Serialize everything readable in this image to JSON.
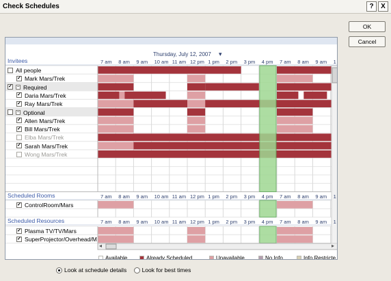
{
  "window": {
    "title": "Check Schedules",
    "help_label": "?",
    "close_label": "X"
  },
  "buttons": {
    "ok": "OK",
    "cancel": "Cancel"
  },
  "date_header": "Thursday, July 12, 2007",
  "sections": {
    "invitees": "Invitees",
    "rooms": "Scheduled Rooms",
    "resources": "Scheduled Resources"
  },
  "time_labels": [
    "7 am",
    "8 am",
    "9 am",
    "10 am",
    "11 am",
    "12 pm",
    "1 pm",
    "2 pm",
    "3 pm",
    "4 pm",
    "7 am",
    "8 am",
    "9 am",
    "1"
  ],
  "invitees": [
    {
      "label": "All people",
      "checkbox": "empty",
      "indent": 0,
      "dim": false
    },
    {
      "label": "Mark Mars/Trek",
      "checkbox": "checked",
      "indent": 1,
      "dim": false
    },
    {
      "label": "Required",
      "checkbox": "checked",
      "expander": "−",
      "indent": 0,
      "dim": false
    },
    {
      "label": "Daria Mars/Trek",
      "checkbox": "checked",
      "indent": 1,
      "dim": false
    },
    {
      "label": "Ray Mars/Trek",
      "checkbox": "checked",
      "indent": 1,
      "dim": false
    },
    {
      "label": "Optional",
      "checkbox": "empty",
      "expander": "−",
      "indent": 0,
      "dim": false
    },
    {
      "label": "Allen Mars/Trek",
      "checkbox": "checked",
      "indent": 1,
      "dim": false
    },
    {
      "label": "Bill Mars/Trek",
      "checkbox": "checked",
      "indent": 1,
      "dim": false
    },
    {
      "label": "Elba Mars/Trek",
      "checkbox": "empty",
      "indent": 1,
      "dim": true
    },
    {
      "label": "Sarah Mars/Trek",
      "checkbox": "checked",
      "indent": 1,
      "dim": false
    },
    {
      "label": "Wong Mars/Trek",
      "checkbox": "empty",
      "indent": 1,
      "dim": true
    }
  ],
  "rooms": [
    {
      "label": "ControlRoom/Mars",
      "checkbox": "checked"
    }
  ],
  "resources": [
    {
      "label": "Plasma TV/TV/Mars",
      "checkbox": "checked"
    },
    {
      "label": "SuperProjector/Overhead/M",
      "checkbox": "checked"
    }
  ],
  "legend": [
    {
      "label": "Available",
      "color": "#ffffff"
    },
    {
      "label": "Already Scheduled",
      "color": "#a4343c"
    },
    {
      "label": "Unavailable",
      "color": "#dea0a4"
    },
    {
      "label": "No Info",
      "color": "#b49fb0"
    },
    {
      "label": "Info Restricte",
      "color": "#d8d0b4"
    }
  ],
  "options": {
    "details": "Look at schedule details",
    "best": "Look for best times",
    "selected": "details"
  },
  "colors": {
    "busy": "#a4343c",
    "unavailable": "#dea0a4",
    "selection": "#9fd892",
    "header_text": "#3b5aa8"
  }
}
